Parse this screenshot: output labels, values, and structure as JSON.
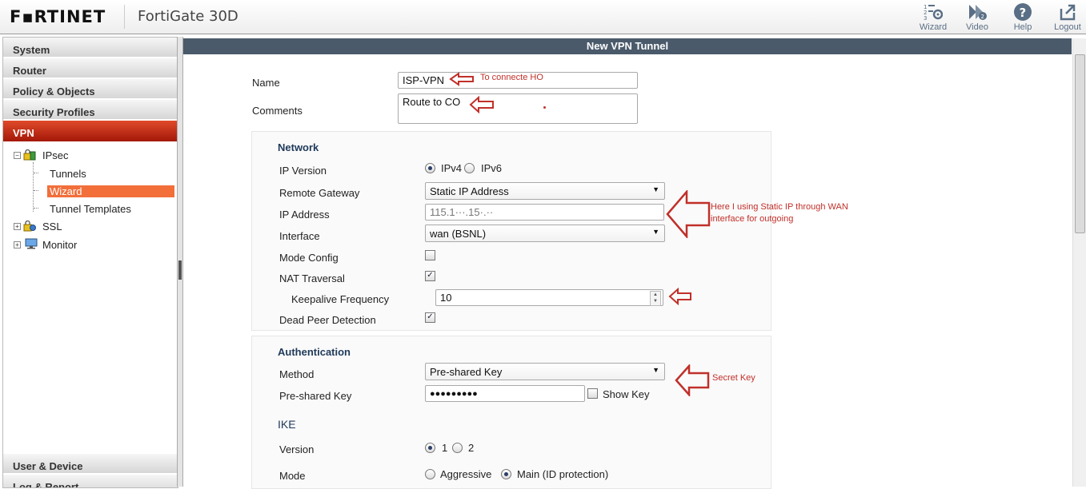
{
  "header": {
    "logo": "F▪RTINET",
    "model": "FortiGate 30D",
    "toolbar": [
      {
        "label": "Wizard",
        "icon": "wizard-icon"
      },
      {
        "label": "Video",
        "icon": "video-icon"
      },
      {
        "label": "Help",
        "icon": "help-icon"
      },
      {
        "label": "Logout",
        "icon": "logout-icon"
      }
    ]
  },
  "sidebar": {
    "sections": [
      "System",
      "Router",
      "Policy & Objects",
      "Security Profiles",
      "VPN"
    ],
    "active": "VPN",
    "tree": {
      "ipsec": "IPsec",
      "tunnels": "Tunnels",
      "wizard": "Wizard",
      "tunnel_templates": "Tunnel Templates",
      "ssl": "SSL",
      "monitor": "Monitor"
    },
    "bottom_sections": [
      "User & Device",
      "Log & Report"
    ]
  },
  "main": {
    "title": "New VPN Tunnel",
    "name_label": "Name",
    "name_value": "ISP-VPN",
    "comments_label": "Comments",
    "comments_value": "Route to CO",
    "network": {
      "title": "Network",
      "ip_version_label": "IP Version",
      "ipv4": "IPv4",
      "ipv6": "IPv6",
      "remote_gateway_label": "Remote Gateway",
      "remote_gateway_value": "Static IP Address",
      "ip_address_label": "IP Address",
      "ip_address_value": "115.1···.15·.··",
      "interface_label": "Interface",
      "interface_value": "wan (BSNL)",
      "mode_config_label": "Mode Config",
      "nat_traversal_label": "NAT Traversal",
      "keepalive_label": "Keepalive Frequency",
      "keepalive_value": "10",
      "dpd_label": "Dead Peer Detection"
    },
    "authentication": {
      "title": "Authentication",
      "method_label": "Method",
      "method_value": "Pre-shared Key",
      "psk_label": "Pre-shared Key",
      "psk_value": "●●●●●●●●●",
      "show_key_label": "Show Key"
    },
    "ike": {
      "title": "IKE",
      "version_label": "Version",
      "version_1": "1",
      "version_2": "2",
      "mode_label": "Mode",
      "aggressive": "Aggressive",
      "main_mode": "Main (ID protection)"
    }
  },
  "annotations": {
    "name_note": "To connecte HO",
    "ip_note_line1": "Here I using Static IP through WAN",
    "ip_note_line2": "interface for outgoing",
    "secret_note": "Secret Key",
    "arrow_color": "#c0302a"
  },
  "colors": {
    "active_section": "#c2321a",
    "title_bar": "#4a5a6b",
    "selection": "#f26f3a",
    "section_title": "#1f3a5a"
  }
}
